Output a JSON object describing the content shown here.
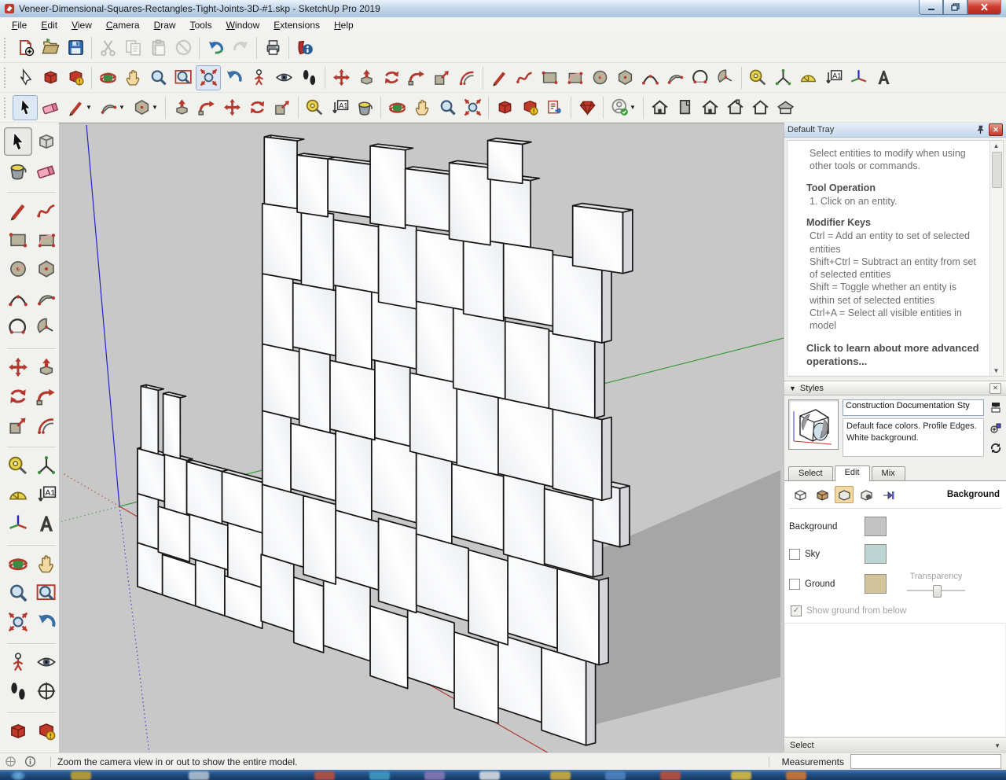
{
  "window": {
    "title": "Veneer-Dimensional-Squares-Rectangles-Tight-Joints-3D-#1.skp - SketchUp Pro 2019",
    "controls": [
      "minimize",
      "restore",
      "close"
    ]
  },
  "menu": {
    "items": [
      "File",
      "Edit",
      "View",
      "Camera",
      "Draw",
      "Tools",
      "Window",
      "Extensions",
      "Help"
    ]
  },
  "toolbars": {
    "row1": [
      {
        "name": "new-document",
        "icon": "new"
      },
      {
        "name": "open-document",
        "icon": "open"
      },
      {
        "name": "save-document",
        "icon": "save"
      },
      {
        "name": "sep"
      },
      {
        "name": "cut",
        "icon": "cut",
        "disabled": true
      },
      {
        "name": "copy",
        "icon": "copy",
        "disabled": true
      },
      {
        "name": "paste",
        "icon": "paste",
        "disabled": true
      },
      {
        "name": "erase-command",
        "icon": "erase",
        "disabled": true
      },
      {
        "name": "sep"
      },
      {
        "name": "undo",
        "icon": "undo"
      },
      {
        "name": "redo",
        "icon": "redo",
        "disabled": true
      },
      {
        "name": "sep"
      },
      {
        "name": "print",
        "icon": "print"
      },
      {
        "name": "sep"
      },
      {
        "name": "model-info",
        "icon": "minfo"
      }
    ],
    "row2": [
      {
        "name": "pick-tool",
        "icon": "pick"
      },
      {
        "name": "make-component",
        "icon": "wh"
      },
      {
        "name": "shared-component",
        "icon": "wh2"
      },
      {
        "name": "sep"
      },
      {
        "name": "orbit-tool",
        "icon": "orbit"
      },
      {
        "name": "pan-tool",
        "icon": "pan"
      },
      {
        "name": "zoom-tool",
        "icon": "zoom"
      },
      {
        "name": "zoom-window-tool",
        "icon": "zoomwin"
      },
      {
        "name": "zoom-extents-tool",
        "icon": "zoomext",
        "pressed": true
      },
      {
        "name": "previous-view",
        "icon": "prev"
      },
      {
        "name": "position-camera-tool",
        "icon": "poscam"
      },
      {
        "name": "look-around-tool",
        "icon": "look"
      },
      {
        "name": "walk-tool",
        "icon": "walk"
      },
      {
        "name": "sep"
      },
      {
        "name": "move-tool",
        "icon": "move"
      },
      {
        "name": "push-pull-tool",
        "icon": "pushpull"
      },
      {
        "name": "rotate-tool",
        "icon": "rotate"
      },
      {
        "name": "follow-me-tool",
        "icon": "followme"
      },
      {
        "name": "scale-tool",
        "icon": "scale"
      },
      {
        "name": "offset-tool",
        "icon": "offset"
      },
      {
        "name": "sep"
      },
      {
        "name": "line-tool",
        "icon": "line"
      },
      {
        "name": "freehand-tool",
        "icon": "freehand"
      },
      {
        "name": "rectangle-tool",
        "icon": "rect"
      },
      {
        "name": "rotated-rectangle-tool",
        "icon": "rotrect"
      },
      {
        "name": "circle-tool",
        "icon": "circle"
      },
      {
        "name": "polygon-tool",
        "icon": "polygon"
      },
      {
        "name": "arc-tool",
        "icon": "arc"
      },
      {
        "name": "two-point-arc-tool",
        "icon": "arc2"
      },
      {
        "name": "three-point-arc-tool",
        "icon": "arc3"
      },
      {
        "name": "pie-tool",
        "icon": "pie"
      },
      {
        "name": "sep"
      },
      {
        "name": "tape-measure-tool",
        "icon": "tape"
      },
      {
        "name": "dimension-tool",
        "icon": "dims"
      },
      {
        "name": "protractor-tool",
        "icon": "protractor"
      },
      {
        "name": "text-tool",
        "icon": "text"
      },
      {
        "name": "axes-tool",
        "icon": "axes"
      },
      {
        "name": "3d-text-tool",
        "icon": "t3d"
      }
    ],
    "row3": [
      {
        "name": "select-tool",
        "icon": "cursor",
        "pressed": true
      },
      {
        "name": "eraser-tool",
        "icon": "eraser"
      },
      {
        "name": "line-tool",
        "icon": "line",
        "dropdown": true
      },
      {
        "name": "arc-tool",
        "icon": "arc2",
        "dropdown": true
      },
      {
        "name": "shapes-tool",
        "icon": "polygon",
        "dropdown": true
      },
      {
        "name": "sep"
      },
      {
        "name": "push-pull-tool",
        "icon": "pushpull"
      },
      {
        "name": "follow-me-tool",
        "icon": "followme"
      },
      {
        "name": "move-tool",
        "icon": "move"
      },
      {
        "name": "rotate-tool",
        "icon": "rotate"
      },
      {
        "name": "scale-tool",
        "icon": "scale"
      },
      {
        "name": "sep"
      },
      {
        "name": "tape-measure-tool",
        "icon": "tape"
      },
      {
        "name": "text-tool",
        "icon": "text"
      },
      {
        "name": "paint-bucket-tool",
        "icon": "paint"
      },
      {
        "name": "sep"
      },
      {
        "name": "orbit-tool",
        "icon": "orbit"
      },
      {
        "name": "pan-tool",
        "icon": "pan"
      },
      {
        "name": "zoom-tool",
        "icon": "zoom"
      },
      {
        "name": "zoom-extents-tool",
        "icon": "zoomext"
      },
      {
        "name": "sep"
      },
      {
        "name": "3d-warehouse",
        "icon": "wh"
      },
      {
        "name": "share-model",
        "icon": "wh2"
      },
      {
        "name": "share-component",
        "icon": "wh3"
      },
      {
        "name": "sep"
      },
      {
        "name": "extension-warehouse",
        "icon": "ruby"
      },
      {
        "name": "sep"
      },
      {
        "name": "account",
        "icon": "account",
        "dropdown": true
      },
      {
        "name": "sep"
      },
      {
        "name": "view-iso",
        "icon": "house"
      },
      {
        "name": "view-top",
        "icon": "houseTop"
      },
      {
        "name": "view-front",
        "icon": "house"
      },
      {
        "name": "view-back",
        "icon": "houseBack"
      },
      {
        "name": "view-left",
        "icon": "houseOutline"
      },
      {
        "name": "view-right",
        "icon": "houseRight"
      }
    ],
    "left": [
      {
        "name": "select-tool",
        "icon": "cursor",
        "pressed": true
      },
      {
        "name": "make-component",
        "icon": "whGray"
      },
      {
        "name": "paint-bucket-tool",
        "icon": "paint"
      },
      {
        "name": "eraser-tool",
        "icon": "eraser"
      },
      {
        "name": "sep"
      },
      {
        "name": "line-tool",
        "icon": "line"
      },
      {
        "name": "freehand-tool",
        "icon": "freehand"
      },
      {
        "name": "rectangle-tool",
        "icon": "rect"
      },
      {
        "name": "rotated-rectangle-tool",
        "icon": "rotrect"
      },
      {
        "name": "circle-tool",
        "icon": "circle"
      },
      {
        "name": "polygon-tool",
        "icon": "polygon"
      },
      {
        "name": "arc-tool",
        "icon": "arc"
      },
      {
        "name": "two-point-arc-tool",
        "icon": "arc2"
      },
      {
        "name": "three-point-arc-tool",
        "icon": "arc3"
      },
      {
        "name": "pie-tool",
        "icon": "pie"
      },
      {
        "name": "sep"
      },
      {
        "name": "move-tool",
        "icon": "move"
      },
      {
        "name": "push-pull-tool",
        "icon": "pushpull"
      },
      {
        "name": "rotate-tool",
        "icon": "rotate"
      },
      {
        "name": "follow-me-tool",
        "icon": "followme"
      },
      {
        "name": "scale-tool",
        "icon": "scale"
      },
      {
        "name": "offset-tool",
        "icon": "offset"
      },
      {
        "name": "sep"
      },
      {
        "name": "tape-measure-tool",
        "icon": "tape"
      },
      {
        "name": "dimension-tool",
        "icon": "dims"
      },
      {
        "name": "protractor-tool",
        "icon": "protractor"
      },
      {
        "name": "text-tool",
        "icon": "text"
      },
      {
        "name": "axes-tool",
        "icon": "axes"
      },
      {
        "name": "3d-text-tool",
        "icon": "t3d"
      },
      {
        "name": "sep"
      },
      {
        "name": "orbit-tool",
        "icon": "orbit"
      },
      {
        "name": "pan-tool",
        "icon": "pan"
      },
      {
        "name": "zoom-tool",
        "icon": "zoom"
      },
      {
        "name": "zoom-window-tool",
        "icon": "zoomwin"
      },
      {
        "name": "zoom-extents-tool",
        "icon": "zoomext"
      },
      {
        "name": "previous-view",
        "icon": "prev"
      },
      {
        "name": "sep"
      },
      {
        "name": "position-camera-tool",
        "icon": "poscam"
      },
      {
        "name": "look-around-tool",
        "icon": "look"
      },
      {
        "name": "walk-tool",
        "icon": "walk"
      },
      {
        "name": "section-plane-tool",
        "icon": "section"
      },
      {
        "name": "sep"
      },
      {
        "name": "3d-warehouse",
        "icon": "wh"
      },
      {
        "name": "share-model",
        "icon": "wh2"
      },
      {
        "name": "share-component",
        "icon": "wh3"
      },
      {
        "name": "extension-warehouse",
        "icon": "ruby"
      }
    ]
  },
  "canvas": {
    "background": "#c8c8c8",
    "axes": {
      "red": "#b03a2e",
      "green": "#3c9b3c",
      "blue": "#2424c8"
    },
    "shadow_color": "#a6a6a7",
    "model": {
      "blocks": [
        {
          "u": 0.0,
          "v": 0.0,
          "w": 0.72,
          "h": 0.66,
          "l": 1
        },
        {
          "u": 0.72,
          "v": 0.0,
          "w": 0.92,
          "h": 0.6
        },
        {
          "u": 1.64,
          "v": 0.0,
          "w": 0.78,
          "h": 0.68
        },
        {
          "u": 2.42,
          "v": 0.0,
          "w": 0.96,
          "h": 0.58
        },
        {
          "u": 0.0,
          "v": 0.66,
          "w": 0.6,
          "h": 0.74,
          "l": 1
        },
        {
          "u": 0.6,
          "v": 0.62,
          "w": 0.88,
          "h": 0.68
        },
        {
          "u": 1.48,
          "v": 0.68,
          "w": 1.02,
          "h": 0.64
        },
        {
          "u": 2.5,
          "v": 0.58,
          "w": 0.88,
          "h": 0.78
        },
        {
          "u": 0.0,
          "v": 1.4,
          "w": 0.78,
          "h": 0.68,
          "l": 1,
          "t": 1
        },
        {
          "u": 0.78,
          "v": 1.3,
          "w": 0.62,
          "h": 0.8,
          "t": 1
        },
        {
          "u": 1.4,
          "v": 1.32,
          "w": 0.95,
          "h": 0.76,
          "t": 1
        },
        {
          "u": 2.35,
          "v": 1.36,
          "w": 1.03,
          "h": 0.72,
          "t": 1
        },
        {
          "u": 0.1,
          "v": 2.08,
          "w": 0.5,
          "h": 0.95,
          "t": 1,
          "l": 1
        },
        {
          "u": 0.74,
          "v": 2.1,
          "w": 0.48,
          "h": 0.9,
          "t": 1
        },
        {
          "u": 3.35,
          "v": 0.1,
          "w": 0.8,
          "h": 0.95
        },
        {
          "u": 4.15,
          "v": -0.05,
          "w": 0.7,
          "h": 0.92
        },
        {
          "u": 4.85,
          "v": 0.05,
          "w": 1.05,
          "h": 1.0
        },
        {
          "u": 5.9,
          "v": -0.15,
          "w": 0.8,
          "h": 0.95
        },
        {
          "u": 6.7,
          "v": 0.0,
          "w": 0.95,
          "h": 0.92
        },
        {
          "u": 7.65,
          "v": -0.2,
          "w": 0.85,
          "h": 1.0
        },
        {
          "u": 8.5,
          "v": 0.0,
          "w": 0.8,
          "h": 0.95
        },
        {
          "u": 9.3,
          "v": -0.1,
          "w": 0.78,
          "h": 1.05,
          "r": 1
        },
        {
          "u": 3.38,
          "v": 1.05,
          "w": 1.0,
          "h": 1.0
        },
        {
          "u": 4.38,
          "v": 0.95,
          "w": 0.75,
          "h": 1.1
        },
        {
          "u": 5.13,
          "v": 1.05,
          "w": 0.95,
          "h": 0.92
        },
        {
          "u": 6.08,
          "v": 0.9,
          "w": 0.8,
          "h": 1.12
        },
        {
          "u": 6.88,
          "v": 1.0,
          "w": 1.05,
          "h": 0.95
        },
        {
          "u": 7.93,
          "v": 0.85,
          "w": 0.75,
          "h": 1.08
        },
        {
          "u": 8.68,
          "v": 1.0,
          "w": 0.9,
          "h": 1.0
        },
        {
          "u": 9.58,
          "v": 0.95,
          "w": 0.72,
          "h": 1.05,
          "r": 1
        },
        {
          "u": 3.38,
          "v": 2.05,
          "w": 0.7,
          "h": 1.05
        },
        {
          "u": 4.08,
          "v": 2.1,
          "w": 1.05,
          "h": 0.92
        },
        {
          "u": 5.13,
          "v": 1.97,
          "w": 0.8,
          "h": 1.1
        },
        {
          "u": 5.93,
          "v": 2.1,
          "w": 0.95,
          "h": 1.0
        },
        {
          "u": 6.88,
          "v": 1.95,
          "w": 0.72,
          "h": 1.08
        },
        {
          "u": 7.6,
          "v": 2.05,
          "w": 1.0,
          "h": 0.95
        },
        {
          "u": 8.6,
          "v": 2.0,
          "w": 0.75,
          "h": 1.02
        },
        {
          "u": 9.35,
          "v": 2.02,
          "w": 0.85,
          "h": 0.95,
          "r": 1
        },
        {
          "u": 10.2,
          "v": 2.48,
          "w": 0.45,
          "h": 0.72,
          "t": 1,
          "r": 1
        },
        {
          "u": 3.38,
          "v": 3.1,
          "w": 0.9,
          "h": 0.95
        },
        {
          "u": 4.28,
          "v": 3.02,
          "w": 0.72,
          "h": 1.08
        },
        {
          "u": 5.0,
          "v": 3.07,
          "w": 1.0,
          "h": 0.95
        },
        {
          "u": 6.0,
          "v": 3.1,
          "w": 0.75,
          "h": 1.05
        },
        {
          "u": 6.75,
          "v": 3.03,
          "w": 0.95,
          "h": 1.05
        },
        {
          "u": 7.7,
          "v": 3.0,
          "w": 0.8,
          "h": 1.0
        },
        {
          "u": 8.5,
          "v": 3.02,
          "w": 1.0,
          "h": 0.98
        },
        {
          "u": 9.5,
          "v": 3.0,
          "w": 0.85,
          "h": 1.0,
          "r": 1
        },
        {
          "u": 3.38,
          "v": 4.05,
          "w": 0.75,
          "h": 1.0
        },
        {
          "u": 4.13,
          "v": 4.1,
          "w": 1.0,
          "h": 0.9
        },
        {
          "u": 5.13,
          "v": 4.02,
          "w": 0.8,
          "h": 1.05
        },
        {
          "u": 5.93,
          "v": 4.15,
          "w": 0.95,
          "h": 0.92
        },
        {
          "u": 6.88,
          "v": 4.08,
          "w": 0.75,
          "h": 1.0
        },
        {
          "u": 7.63,
          "v": 4.0,
          "w": 1.0,
          "h": 1.08
        },
        {
          "u": 8.63,
          "v": 4.0,
          "w": 0.8,
          "h": 1.0
        },
        {
          "u": 9.43,
          "v": 4.0,
          "w": 0.8,
          "h": 0.98,
          "r": 1
        },
        {
          "u": 3.38,
          "v": 5.05,
          "w": 0.95,
          "h": 1.0
        },
        {
          "u": 4.33,
          "v": 5.0,
          "w": 0.75,
          "h": 1.05
        },
        {
          "u": 5.08,
          "v": 5.07,
          "w": 1.0,
          "h": 0.9
        },
        {
          "u": 6.08,
          "v": 4.95,
          "w": 0.8,
          "h": 1.1
        },
        {
          "u": 6.88,
          "v": 5.05,
          "w": 0.95,
          "h": 0.95
        },
        {
          "u": 7.83,
          "v": 5.0,
          "w": 0.77,
          "h": 1.0
        },
        {
          "u": 8.6,
          "v": 5.05,
          "w": 0.9,
          "h": 0.95
        },
        {
          "u": 9.5,
          "v": 4.95,
          "w": 0.85,
          "h": 1.0,
          "r": 1
        },
        {
          "u": 9.85,
          "v": 5.85,
          "w": 0.85,
          "h": 0.75,
          "t": 1,
          "r": 1
        },
        {
          "u": 3.43,
          "v": 6.05,
          "w": 0.8,
          "h": 0.95,
          "t": 1,
          "l": 1
        },
        {
          "u": 4.23,
          "v": 6.0,
          "w": 0.72,
          "h": 0.8,
          "t": 1
        },
        {
          "u": 4.95,
          "v": 6.08,
          "w": 0.95,
          "h": 0.72,
          "t": 1
        },
        {
          "u": 5.9,
          "v": 6.0,
          "w": 0.75,
          "h": 1.05,
          "t": 1
        },
        {
          "u": 6.65,
          "v": 6.05,
          "w": 0.9,
          "h": 0.75,
          "t": 1
        },
        {
          "u": 7.55,
          "v": 5.95,
          "w": 0.8,
          "h": 1.0,
          "t": 1
        },
        {
          "u": 8.35,
          "v": 6.0,
          "w": 0.75,
          "h": 0.85,
          "t": 1
        },
        {
          "u": 8.3,
          "v": 6.8,
          "w": 0.65,
          "h": 0.5,
          "t": 1
        }
      ]
    }
  },
  "tray": {
    "title": "Default Tray",
    "instructor": {
      "intro": "Select entities to modify when using other tools or commands.",
      "sections": [
        {
          "title": "Tool Operation",
          "lines": [
            "1. Click on an entity."
          ]
        },
        {
          "title": "Modifier Keys",
          "lines": [
            "Ctrl = Add an entity to set of selected entities",
            "Shift+Ctrl = Subtract an entity from set of selected entities",
            "Shift = Toggle whether an entity is within set of selected entities",
            "Ctrl+A = Select all visible entities in model"
          ]
        }
      ],
      "footer": "Click to learn about more advanced operations..."
    },
    "styles": {
      "header": "Styles",
      "style_name": "Construction Documentation Sty",
      "description": "Default face colors. Profile Edges. White background.",
      "tabs": [
        "Select",
        "Edit",
        "Mix"
      ],
      "active_tab": "Edit",
      "section_label": "Background",
      "rows": {
        "background_label": "Background",
        "sky_label": "Sky",
        "ground_label": "Ground",
        "transparency_label": "Transparency",
        "show_ground_label": "Show ground from below"
      },
      "swatches": {
        "background": "#c3c3c3",
        "sky": "#bcd5d3",
        "ground": "#d3c39b"
      },
      "sky_checked": false,
      "ground_checked": false,
      "show_ground_checked": true
    },
    "bottom_panel_label": "Select"
  },
  "status_bar": {
    "hint": "Zoom the camera view in or out to show the entire model.",
    "measurements_label": "Measurements",
    "measurements_value": ""
  }
}
